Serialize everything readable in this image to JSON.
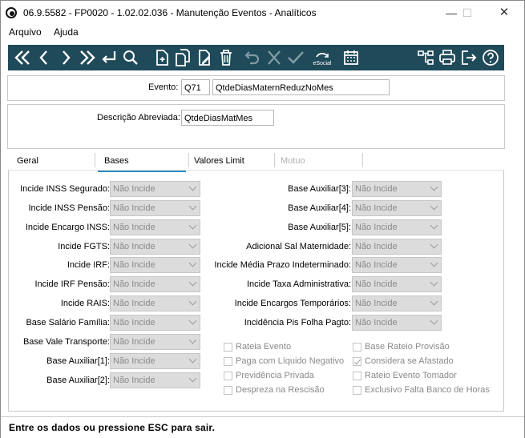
{
  "window": {
    "title": "06.9.5582 - FP0020 - 1.02.02.036 - Manutenção Eventos - Analíticos",
    "minimize": "—",
    "maximize": "☐",
    "close": "✕"
  },
  "menu": [
    "Arquivo",
    "Ajuda"
  ],
  "toolbar": {
    "esocial_label": "eSocial",
    "colors": {
      "background": "#1f4a5a",
      "icon": "#ffffff",
      "disabled_icon": "#7f9aa5"
    }
  },
  "evento": {
    "label": "Evento:",
    "code": "Q71",
    "name": "QtdeDiasMaternReduzNoMes"
  },
  "descricao": {
    "label": "Descrição Abreviada:",
    "value": "QtdeDiasMatMes"
  },
  "tabs": [
    "Geral",
    "Bases",
    "Valores Limit",
    "Mutuo"
  ],
  "active_tab": "Bases",
  "left_fields": [
    {
      "label": "Incide INSS Segurado:",
      "value": "Não Incide"
    },
    {
      "label": "Incide INSS Pensão:",
      "value": "Não Incide"
    },
    {
      "label": "Incide Encargo INSS:",
      "value": "Não Incide"
    },
    {
      "label": "Incide FGTS:",
      "value": "Não Incide"
    },
    {
      "label": "Incide IRF:",
      "value": "Não Incide"
    },
    {
      "label": "Incide IRF Pensão:",
      "value": "Não Incide"
    },
    {
      "label": "Incide RAIS:",
      "value": "Não Incide"
    },
    {
      "label": "Base Salário Família:",
      "value": "Não Incide"
    },
    {
      "label": "Base Vale Transporte:",
      "value": "Não Incide"
    },
    {
      "label": "Base Auxiliar[1]:",
      "value": "Não Incide"
    },
    {
      "label": "Base Auxiliar[2]:",
      "value": "Não Incide"
    }
  ],
  "right_fields": [
    {
      "label": "Base Auxiliar[3]:",
      "value": "Não Incide"
    },
    {
      "label": "Base Auxiliar[4]:",
      "value": "Não Incide"
    },
    {
      "label": "Base Auxiliar[5]:",
      "value": "Não Incide"
    },
    {
      "label": "Adicional Sal Maternidade:",
      "value": "Não Incide"
    },
    {
      "label": "Incide Média Prazo Indeterminado:",
      "value": "Não Incide"
    },
    {
      "label": "Incide Taxa Administrativa:",
      "value": "Não Incide"
    },
    {
      "label": "Incide Encargos Temporários:",
      "value": "Não Incide"
    },
    {
      "label": "Incidência Pis Folha Pagto:",
      "value": "Não Incide"
    }
  ],
  "checkboxes_left": [
    {
      "label": "Rateia Evento",
      "checked": false
    },
    {
      "label": "Paga com Líquido Negativo",
      "checked": false
    },
    {
      "label": "Previdência Privada",
      "checked": false
    },
    {
      "label": "Despreza na Rescisão",
      "checked": false
    }
  ],
  "checkboxes_right": [
    {
      "label": "Base Rateio Provisão",
      "checked": false
    },
    {
      "label": "Considera se Afastado",
      "checked": true
    },
    {
      "label": "Rateio Evento Tomador",
      "checked": false
    },
    {
      "label": "Exclusivo Falta Banco de Horas",
      "checked": false
    }
  ],
  "status": "Entre os dados ou pressione ESC para sair."
}
